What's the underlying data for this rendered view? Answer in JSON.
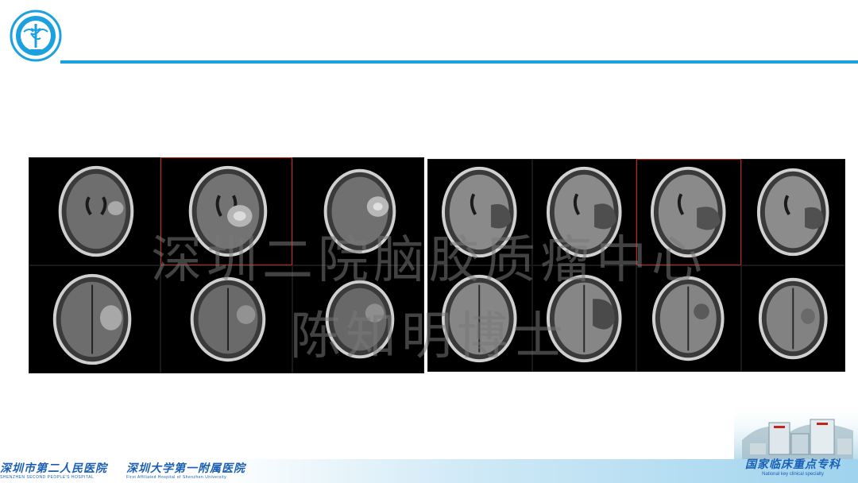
{
  "watermark": {
    "line1": "深圳二院脑胶质瘤中心",
    "line2": "陈知明博士"
  },
  "footer": {
    "hospitals": [
      {
        "cn": "深圳市第二人民医院",
        "en": "SHENZHEN SECOND PEOPLE'S HOSPITAL"
      },
      {
        "cn": "深圳大学第一附属医院",
        "en": "First Affiliated Hospital of Shenzhen University"
      }
    ],
    "specialty": {
      "cn": "国家临床重点专科",
      "en": "National key clinical specialty"
    }
  },
  "colors": {
    "accent": "#1ba1e0",
    "footer_text": "#1a5fb4",
    "highlight_frame": "#c0261c"
  },
  "icons": {
    "logo": "hospital-emblem-icon",
    "building": "hospital-building-image"
  }
}
